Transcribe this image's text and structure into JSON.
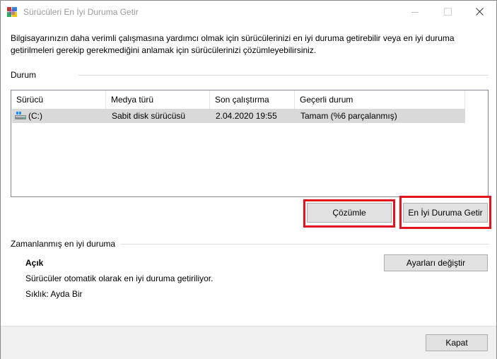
{
  "window": {
    "title": "Sürücüleri En İyi Duruma Getir"
  },
  "description": "Bilgisayarınızın daha verimli çalışmasına yardımcı olmak için sürücülerinizi en iyi duruma getirebilir veya en iyi duruma getirilmeleri gerekip gerekmediğini anlamak için sürücülerinizi çözümleyebilirsiniz.",
  "status_group": {
    "label": "Durum",
    "columns": [
      "Sürücü",
      "Medya türü",
      "Son çalıştırma",
      "Geçerli durum"
    ],
    "rows": [
      {
        "drive": "(C:)",
        "media": "Sabit disk sürücüsü",
        "last_run": "2.04.2020 19:55",
        "status": "Tamam (%6 parçalanmış)",
        "icon": "hard-drive-icon"
      }
    ]
  },
  "buttons": {
    "analyze": "Çözümle",
    "optimize": "En İyi Duruma Getir",
    "change_settings": "Ayarları değiştir",
    "close": "Kapat"
  },
  "scheduled": {
    "label": "Zamanlanmış en iyi duruma",
    "state": "Açık",
    "info": "Sürücüler otomatik olarak en iyi duruma getiriliyor.",
    "frequency": "Sıklık: Ayda Bir"
  },
  "colors": {
    "highlight": "#e0141e",
    "selected_row": "#d9d9d9",
    "button_face": "#e1e1e1"
  }
}
